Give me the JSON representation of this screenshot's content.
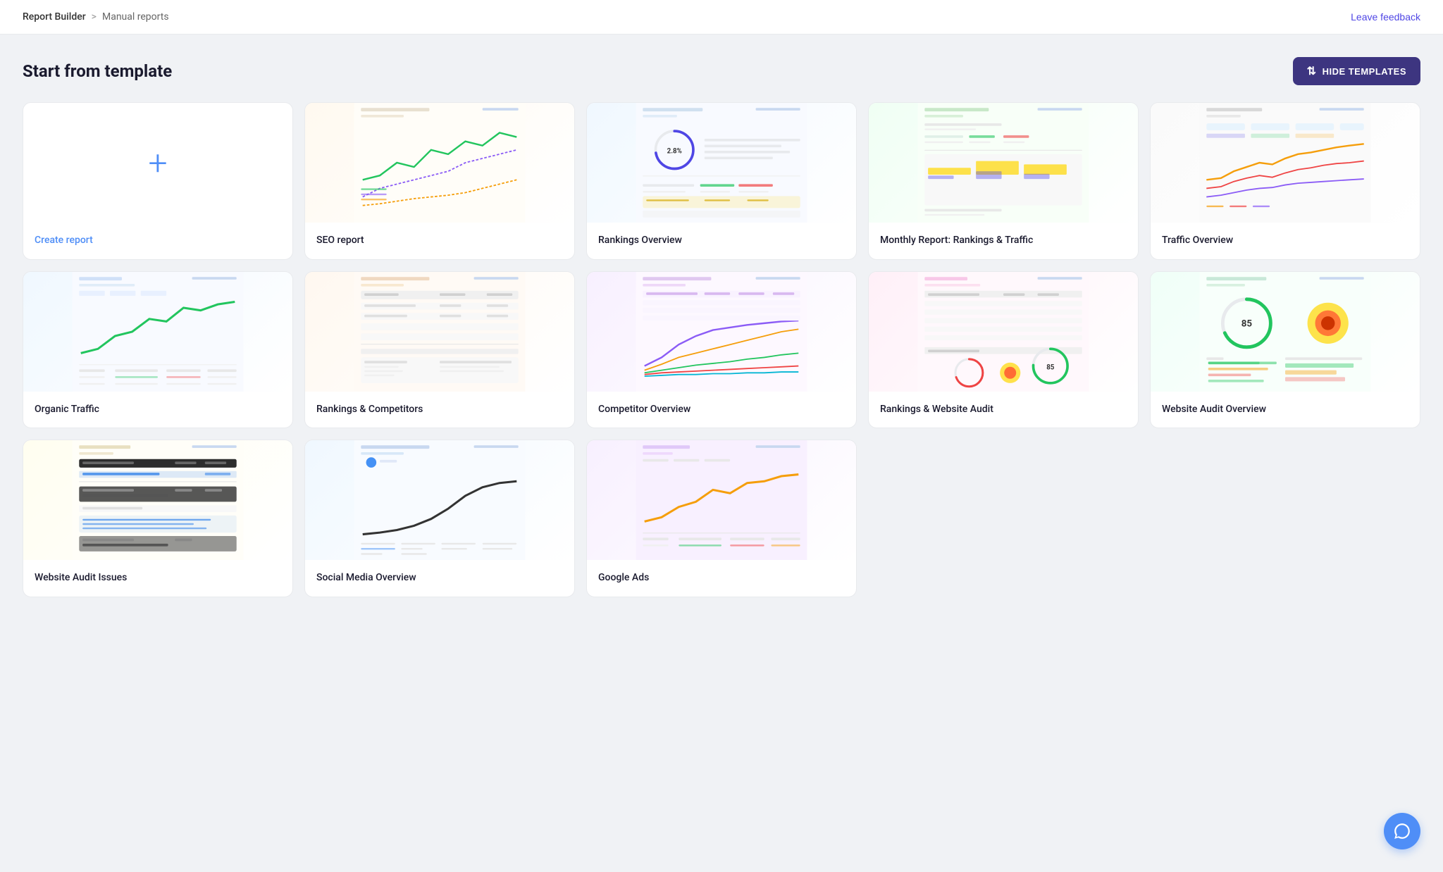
{
  "nav": {
    "breadcrumb_home": "Report Builder",
    "breadcrumb_separator": ">",
    "breadcrumb_current": "Manual reports",
    "leave_feedback": "Leave feedback"
  },
  "page": {
    "title": "Start from template",
    "hide_templates_label": "HIDE TEMPLATES"
  },
  "templates": [
    {
      "id": "create-report",
      "name": "Create report",
      "type": "create",
      "color": "#4f8ef7"
    },
    {
      "id": "seo-report",
      "name": "SEO report",
      "type": "seo"
    },
    {
      "id": "rankings-overview",
      "name": "Rankings Overview",
      "type": "rankings"
    },
    {
      "id": "monthly-report",
      "name": "Monthly Report: Rankings & Traffic",
      "type": "monthly"
    },
    {
      "id": "traffic-overview",
      "name": "Traffic Overview",
      "type": "traffic-overview"
    },
    {
      "id": "organic-traffic",
      "name": "Organic Traffic",
      "type": "organic"
    },
    {
      "id": "rankings-competitors",
      "name": "Rankings & Competitors",
      "type": "rankings-comp"
    },
    {
      "id": "competitor-overview",
      "name": "Competitor Overview",
      "type": "competitor"
    },
    {
      "id": "rankings-website-audit",
      "name": "Rankings & Website Audit",
      "type": "rankings-audit"
    },
    {
      "id": "website-audit-overview",
      "name": "Website Audit Overview",
      "type": "website-audit"
    },
    {
      "id": "website-audit-issues",
      "name": "Website Audit Issues",
      "type": "audit-issues"
    },
    {
      "id": "social-media-overview",
      "name": "Social Media Overview",
      "type": "social"
    },
    {
      "id": "google-ads",
      "name": "Google Ads",
      "type": "google-ads"
    }
  ]
}
